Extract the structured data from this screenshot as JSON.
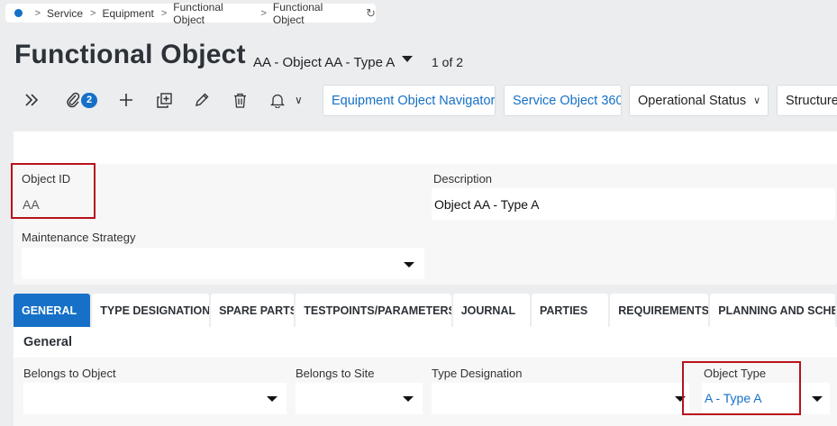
{
  "breadcrumb": {
    "items": [
      "Service",
      "Equipment",
      "Functional Object",
      "Functional Object"
    ]
  },
  "header": {
    "title": "Functional Object",
    "record": "AA - Object AA - Type A",
    "record_position": "1 of 2"
  },
  "toolbar": {
    "expand_icon": "chevrons-right-icon",
    "attachment_icon": "paperclip-icon",
    "attachment_count": "2",
    "add_icon": "plus-icon",
    "duplicate_icon": "duplicate-icon",
    "edit_icon": "pencil-icon",
    "delete_icon": "trash-icon",
    "notify_icon": "bell-icon",
    "buttons": [
      {
        "label": "Equipment Object Navigator"
      },
      {
        "label": "Service Object 360"
      },
      {
        "label": "Operational Status"
      },
      {
        "label": "Structures"
      }
    ]
  },
  "form": {
    "object_id": {
      "label": "Object ID",
      "value": "AA"
    },
    "description": {
      "label": "Description",
      "value": "Object AA - Type A"
    },
    "maintenance_strategy": {
      "label": "Maintenance Strategy",
      "value": ""
    }
  },
  "tabs": [
    {
      "label": "GENERAL",
      "active": true
    },
    {
      "label": "TYPE DESIGNATION"
    },
    {
      "label": "SPARE PARTS"
    },
    {
      "label": "TESTPOINTS/PARAMETERS"
    },
    {
      "label": "JOURNAL"
    },
    {
      "label": "PARTIES"
    },
    {
      "label": "REQUIREMENTS"
    },
    {
      "label": "PLANNING AND SCHE"
    }
  ],
  "general": {
    "title": "General",
    "belongs_to_object": {
      "label": "Belongs to Object",
      "value": ""
    },
    "belongs_to_site": {
      "label": "Belongs to Site",
      "value": ""
    },
    "type_designation": {
      "label": "Type Designation",
      "value": ""
    },
    "object_type": {
      "label": "Object Type",
      "value": "A - Type A"
    }
  },
  "colors": {
    "accent": "#1670c7",
    "highlight": "#b8121b",
    "background": "#ecedef"
  }
}
